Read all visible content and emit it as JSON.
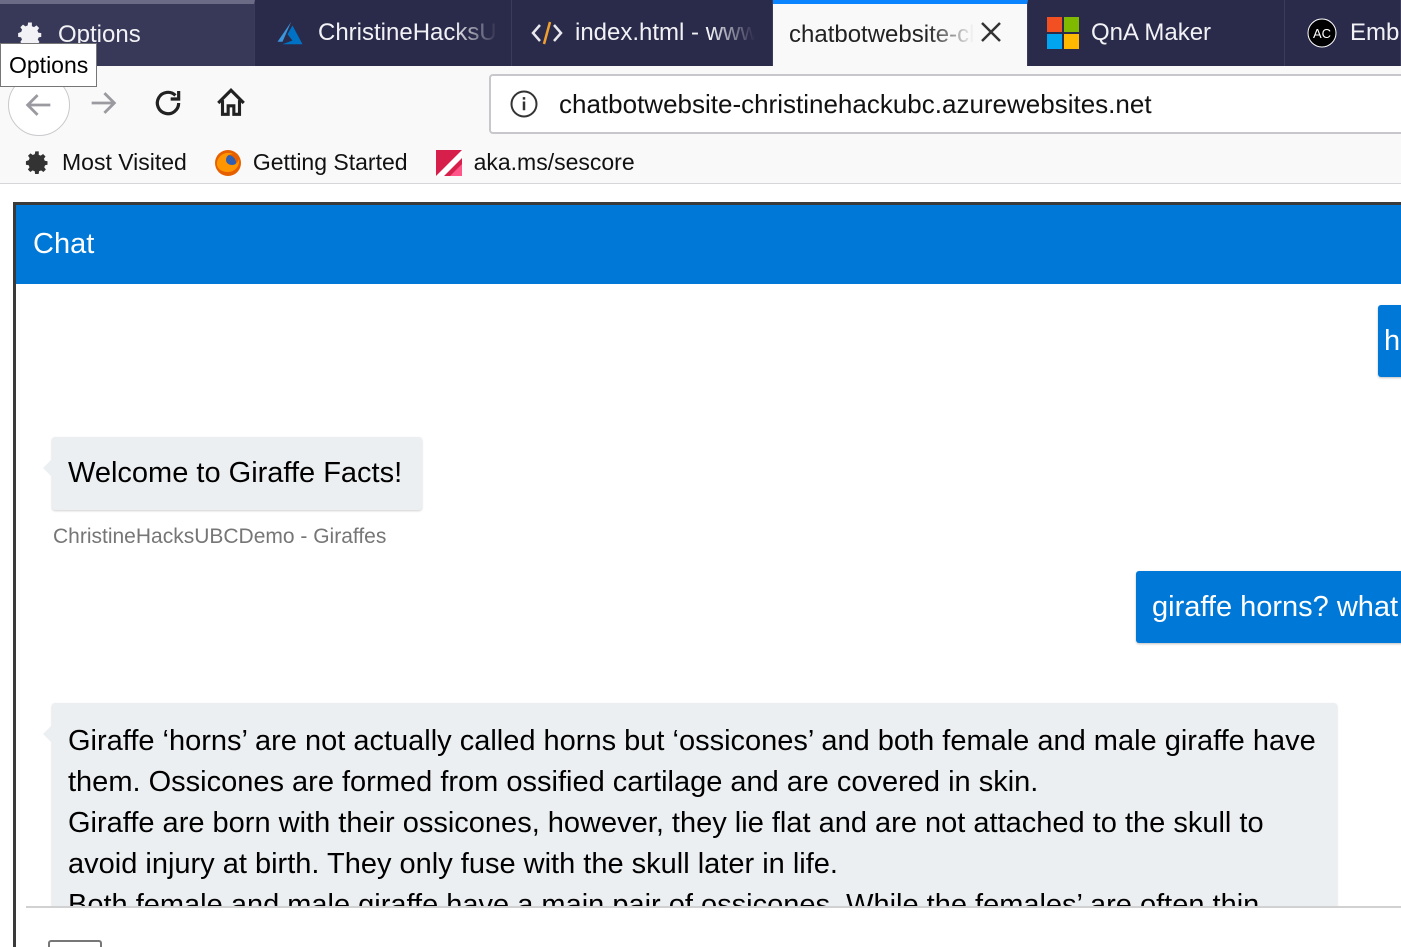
{
  "browser": {
    "tabs": [
      {
        "label": "Options",
        "icon": "gear-icon"
      },
      {
        "label": "ChristineHacksUBC",
        "icon": "azure-icon"
      },
      {
        "label": "index.html - www",
        "icon": "code-icon"
      },
      {
        "label": "chatbotwebsite-christinehackubc",
        "icon": "page-icon",
        "active": true
      },
      {
        "label": "QnA Maker",
        "icon": "microsoft-icon"
      },
      {
        "label": "Embed",
        "icon": "ac-avatar-icon",
        "icon_text": "AC"
      }
    ],
    "tooltip": "Options",
    "url": "chatbotwebsite-christinehackubc.azurewebsites.net",
    "bookmarks": [
      {
        "label": "Most Visited",
        "icon": "gear-icon"
      },
      {
        "label": "Getting Started",
        "icon": "firefox-icon"
      },
      {
        "label": "aka.ms/sescore",
        "icon": "bookmark-red-icon"
      }
    ]
  },
  "chat": {
    "header": "Chat",
    "messages": [
      {
        "from": "user",
        "text": "hi"
      },
      {
        "from": "bot",
        "text": "Welcome to Giraffe Facts!",
        "sender": "ChristineHacksUBCDemo - Giraffes"
      },
      {
        "from": "user",
        "text": "giraffe horns? what"
      },
      {
        "from": "bot",
        "paragraphs": [
          "Giraffe ‘horns’ are not actually called horns but ‘ossicones’ and both female and male giraffe have them. Ossicones are formed from ossified cartilage and are covered in skin.",
          "Giraffe are born with their ossicones, however, they lie flat and are not attached to the skull to avoid injury at birth. They only fuse with the skull later in life.",
          "Both female and male giraffe have a main pair of ossicones. While the females’ are often thin"
        ]
      }
    ]
  }
}
